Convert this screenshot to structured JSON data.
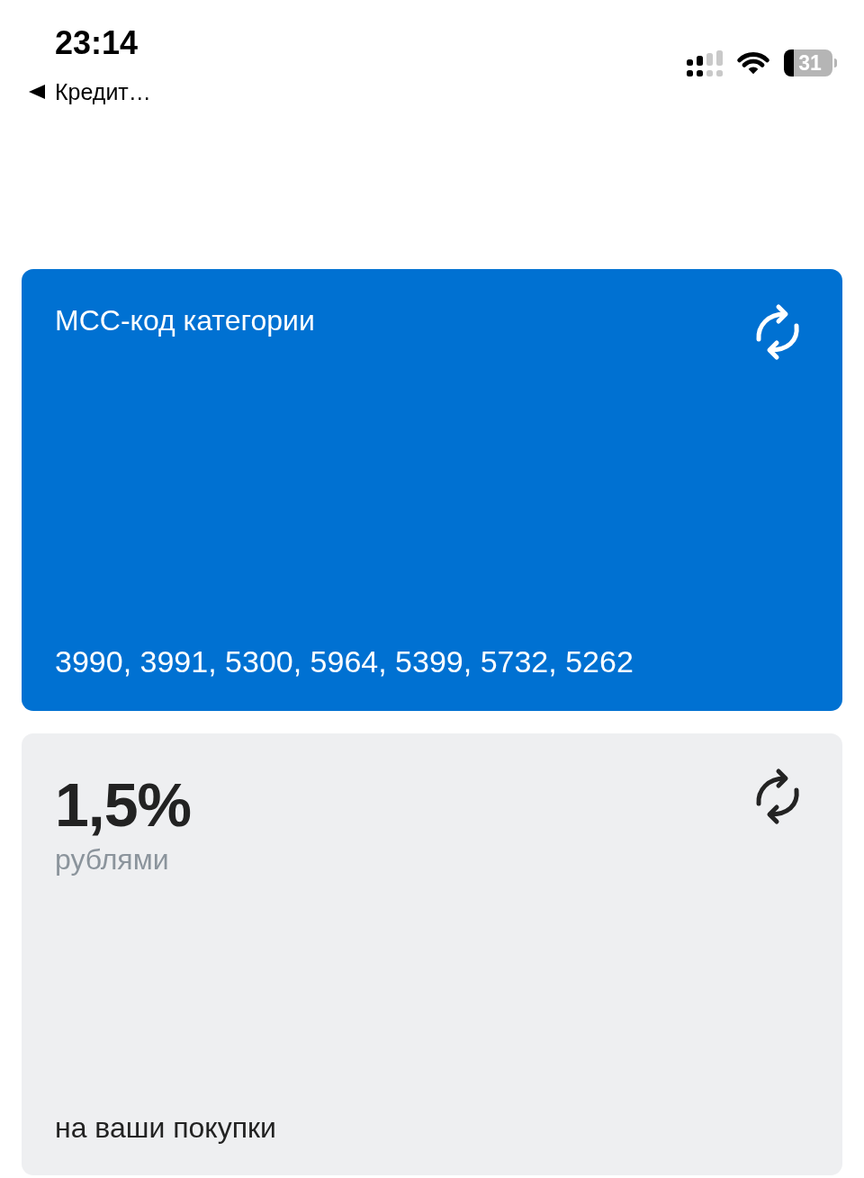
{
  "status_bar": {
    "time": "23:14",
    "back_link": "Кредит…",
    "battery": "31"
  },
  "cards": [
    {
      "kind": "codes",
      "title": "МСС-код категории",
      "codes": "3990, 3991, 5300, 5964, 5399, 5732, 5262"
    },
    {
      "kind": "rate",
      "rate": "1,5%",
      "unit": "рублями",
      "caption": "на ваши покупки"
    }
  ]
}
